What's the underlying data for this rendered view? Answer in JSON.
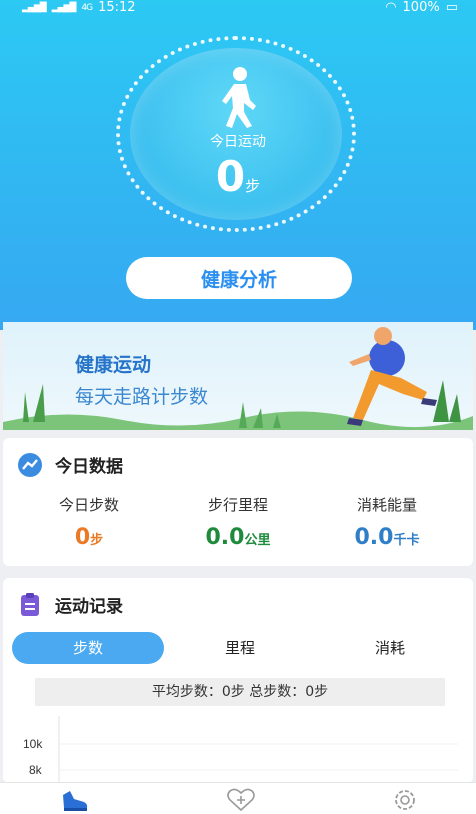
{
  "status_bar": {
    "network": "4G",
    "time": "15:12",
    "battery": "100%"
  },
  "hero": {
    "today_label": "今日运动",
    "steps_value": "0",
    "steps_unit": "步",
    "analysis_button": "健康分析"
  },
  "banner": {
    "line1": "健康运动",
    "line2": "每天走路计步数"
  },
  "today_data": {
    "title": "今日数据",
    "metrics": [
      {
        "label": "今日步数",
        "value": "0",
        "unit": "步",
        "color": "#ea7a25"
      },
      {
        "label": "步行里程",
        "value": "0.0",
        "unit": "公里",
        "color": "#1e8a3c"
      },
      {
        "label": "消耗能量",
        "value": "0.0",
        "unit": "千卡",
        "color": "#2f7fc8"
      }
    ]
  },
  "records": {
    "title": "运动记录",
    "tabs": [
      "步数",
      "里程",
      "消耗"
    ],
    "active_tab": "步数",
    "summary": "平均步数：0步 总步数：0步"
  },
  "chart_data": {
    "type": "bar",
    "categories": [],
    "values": [],
    "ytick_labels": [
      "10k",
      "8k"
    ]
  },
  "nav": {
    "items": [
      "home-shoe-icon",
      "health-heart-icon",
      "settings-gear-icon"
    ],
    "active_color": "#2a6fd6"
  }
}
